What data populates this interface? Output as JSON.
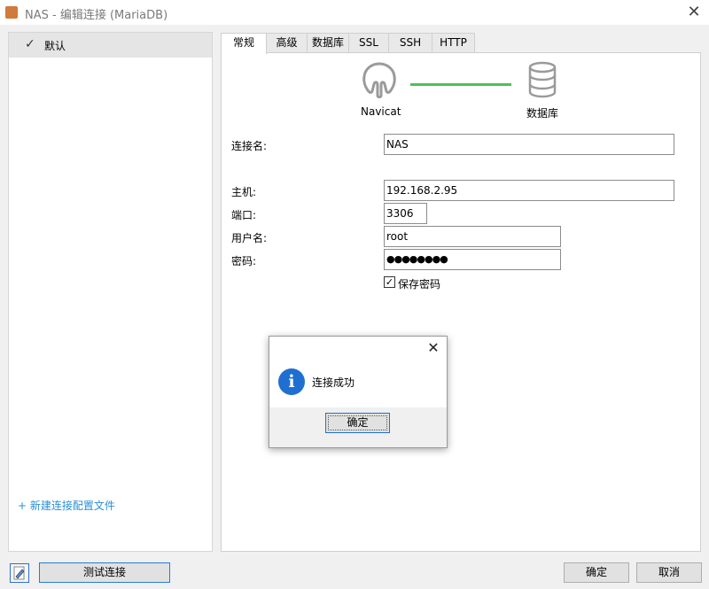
{
  "window": {
    "title": "NAS - 编辑连接 (MariaDB)",
    "close_glyph": "✕"
  },
  "sidebar": {
    "items": [
      {
        "label": "默认",
        "checked_glyph": "✓"
      }
    ],
    "new_profile_link": "+ 新建连接配置文件"
  },
  "tabs": [
    {
      "label": "常规",
      "active": true
    },
    {
      "label": "高级"
    },
    {
      "label": "数据库"
    },
    {
      "label": "SSL"
    },
    {
      "label": "SSH"
    },
    {
      "label": "HTTP"
    }
  ],
  "diagram": {
    "left_label": "Navicat",
    "right_label": "数据库",
    "line_color": "#4fbf5a"
  },
  "form": {
    "connection_name": {
      "label": "连接名:",
      "value": "NAS"
    },
    "host": {
      "label": "主机:",
      "value": "192.168.2.95"
    },
    "port": {
      "label": "端口:",
      "value": "3306"
    },
    "username": {
      "label": "用户名:",
      "value": "root"
    },
    "password": {
      "label": "密码:",
      "value": "●●●●●●●●"
    },
    "save_password": {
      "label": "保存密码",
      "checked": true,
      "glyph": "✓"
    }
  },
  "dialog": {
    "close_glyph": "✕",
    "icon_glyph": "i",
    "message": "连接成功",
    "ok_button": "确定"
  },
  "footer": {
    "test_button": "测试连接",
    "ok_button": "确定",
    "cancel_button": "取消"
  }
}
